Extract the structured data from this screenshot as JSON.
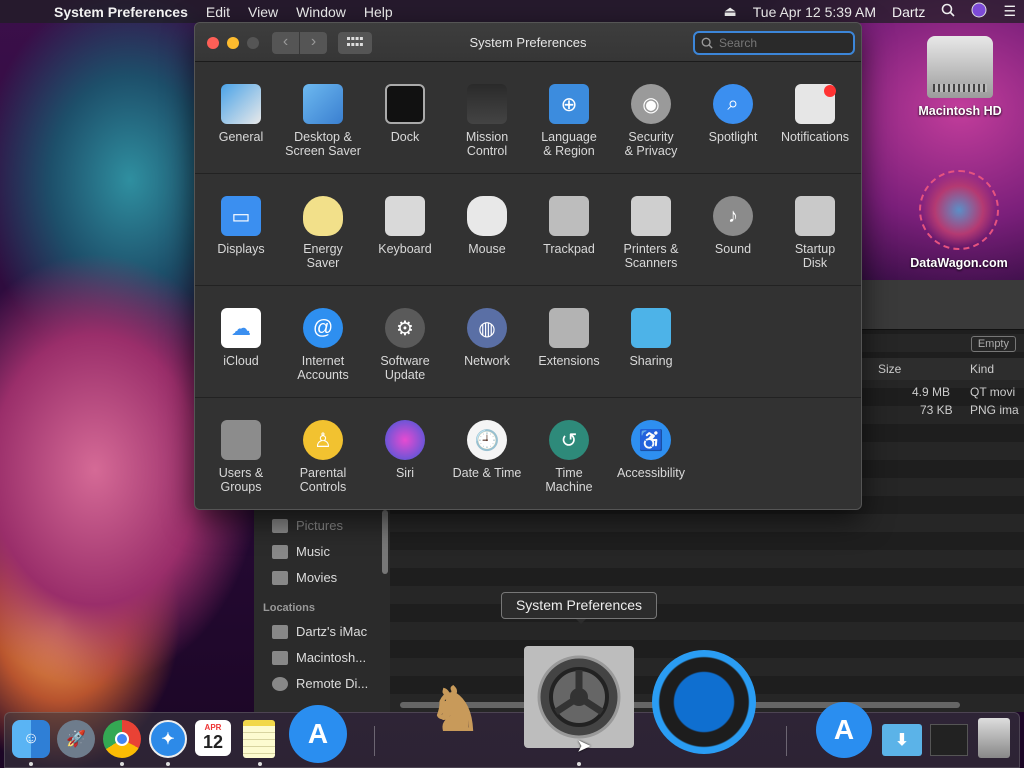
{
  "menubar": {
    "apple": "",
    "app_name": "System Preferences",
    "menus": [
      "Edit",
      "View",
      "Window",
      "Help"
    ],
    "datetime": "Tue Apr 12  5:39 AM",
    "user": "Dartz"
  },
  "desktop": {
    "icons": [
      {
        "label": "Macintosh HD"
      },
      {
        "label": "DataWagon.com"
      }
    ]
  },
  "finder": {
    "empty_label": "Empty",
    "columns": {
      "size": "Size",
      "kind": "Kind"
    },
    "rows": [
      {
        "size": "4.9 MB",
        "kind": "QT movi"
      },
      {
        "size": "73 KB",
        "kind": "PNG ima"
      }
    ],
    "sidebar": {
      "items": [
        "Pictures",
        "Music",
        "Movies"
      ],
      "locations_header": "Locations",
      "locations": [
        "Dartz's iMac",
        "Macintosh...",
        "Remote Di..."
      ]
    }
  },
  "window": {
    "title": "System Preferences",
    "search_placeholder": "Search",
    "rows": [
      [
        {
          "label": "General",
          "icon": "general-icon"
        },
        {
          "label": "Desktop &\nScreen Saver",
          "icon": "desktop-icon"
        },
        {
          "label": "Dock",
          "icon": "dock-icon"
        },
        {
          "label": "Mission\nControl",
          "icon": "mission-control-icon"
        },
        {
          "label": "Language\n& Region",
          "icon": "language-icon"
        },
        {
          "label": "Security\n& Privacy",
          "icon": "security-icon"
        },
        {
          "label": "Spotlight",
          "icon": "spotlight-icon"
        },
        {
          "label": "Notifications",
          "icon": "notifications-icon"
        }
      ],
      [
        {
          "label": "Displays",
          "icon": "displays-icon"
        },
        {
          "label": "Energy\nSaver",
          "icon": "energy-icon"
        },
        {
          "label": "Keyboard",
          "icon": "keyboard-icon"
        },
        {
          "label": "Mouse",
          "icon": "mouse-icon"
        },
        {
          "label": "Trackpad",
          "icon": "trackpad-icon"
        },
        {
          "label": "Printers &\nScanners",
          "icon": "printer-icon"
        },
        {
          "label": "Sound",
          "icon": "sound-icon"
        },
        {
          "label": "Startup\nDisk",
          "icon": "startup-disk-icon"
        }
      ],
      [
        {
          "label": "iCloud",
          "icon": "icloud-icon"
        },
        {
          "label": "Internet\nAccounts",
          "icon": "internet-accounts-icon"
        },
        {
          "label": "Software\nUpdate",
          "icon": "software-update-icon"
        },
        {
          "label": "Network",
          "icon": "network-icon"
        },
        {
          "label": "Extensions",
          "icon": "extensions-icon"
        },
        {
          "label": "Sharing",
          "icon": "sharing-icon"
        }
      ],
      [
        {
          "label": "Users &\nGroups",
          "icon": "users-icon"
        },
        {
          "label": "Parental\nControls",
          "icon": "parental-icon"
        },
        {
          "label": "Siri",
          "icon": "siri-icon"
        },
        {
          "label": "Date & Time",
          "icon": "date-time-icon"
        },
        {
          "label": "Time\nMachine",
          "icon": "time-machine-icon"
        },
        {
          "label": "Accessibility",
          "icon": "accessibility-icon"
        }
      ]
    ]
  },
  "tooltip": "System Preferences",
  "dock": {
    "calendar_month": "APR",
    "calendar_day": "12",
    "items": [
      "finder-icon",
      "launchpad-icon",
      "chrome-icon",
      "safari-icon",
      "calendar-icon",
      "notes-icon",
      "app-store-icon",
      "chess-icon",
      "system-preferences-icon",
      "quicktime-icon",
      "app-store-icon",
      "downloads-icon",
      "document-icon",
      "trash-icon"
    ]
  }
}
